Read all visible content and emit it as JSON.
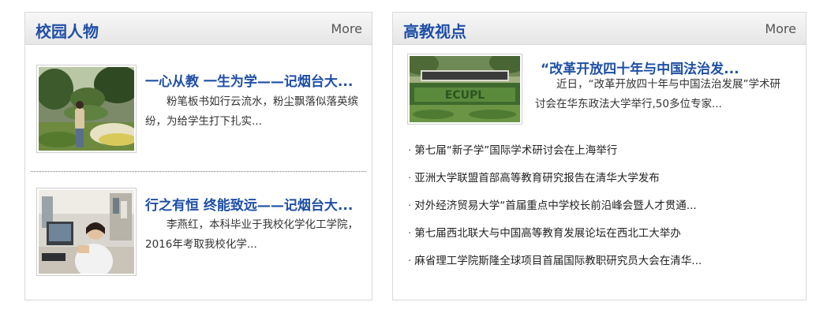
{
  "left_panel": {
    "title": "校园人物",
    "more": "More",
    "items": [
      {
        "title": "一心从教 一生为学——记烟台大...",
        "summary": "粉笔板书如行云流水，粉尘飘落似落英缤纷，为给学生打下扎实...",
        "image": "photo-teacher-in-garden"
      },
      {
        "title": "行之有恒 终能致远——记烟台大...",
        "summary": "李燕红，本科毕业于我校化学化工学院，2016年考取我校化学...",
        "image": "photo-student-in-laboratory"
      }
    ]
  },
  "right_panel": {
    "title": "高教视点",
    "more": "More",
    "featured": {
      "title": "“改革开放四十年与中国法治发...",
      "summary": "近日，“改革开放四十年与中国法治发展”学术研讨会在华东政法大学举行,50多位专家...",
      "image": "photo-university-gate-garden"
    },
    "news": [
      "第七届“新子学”国际学术研讨会在上海举行",
      "亚洲大学联盟首部高等教育研究报告在清华大学发布",
      "对外经济贸易大学“首届重点中学校长前沿峰会暨人才贯通...",
      "第七届西北联大与中国高等教育发展论坛在西北工大举办",
      "麻省理工学院斯隆全球项目首届国际教职研究员大会在清华..."
    ]
  }
}
